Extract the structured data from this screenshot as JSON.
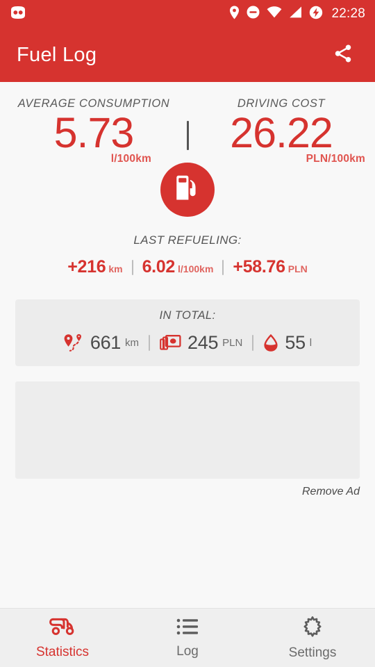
{
  "statusbar": {
    "notification_icon": "cyanogenmod-head-icon",
    "icons": [
      "location-pin-icon",
      "do-not-disturb-icon",
      "wifi-icon",
      "cellular-signal-icon",
      "battery-charging-icon"
    ],
    "time": "22:28"
  },
  "appbar": {
    "title": "Fuel Log",
    "share_label": "Share",
    "icon": "share-icon",
    "bg_color": "#D6332F"
  },
  "summary": {
    "average_consumption": {
      "label": "AVERAGE CONSUMPTION",
      "value": "5.73",
      "unit": "l/100km"
    },
    "driving_cost": {
      "label": "DRIVING COST",
      "value": "26.22",
      "unit": "PLN/100km"
    },
    "badge_icon": "fuel-pump-icon"
  },
  "last_refueling": {
    "title": "LAST REFUELING:",
    "items": [
      {
        "value": "+216",
        "unit": "km"
      },
      {
        "value": "6.02",
        "unit": "l/100km"
      },
      {
        "value": "+58.76",
        "unit": "PLN"
      }
    ]
  },
  "in_total": {
    "title": "IN TOTAL:",
    "items": [
      {
        "icon": "route-pins-icon",
        "value": "661",
        "unit": "km"
      },
      {
        "icon": "banknotes-icon",
        "value": "245",
        "unit": "PLN"
      },
      {
        "icon": "fuel-drop-icon",
        "value": "55",
        "unit": "l"
      }
    ]
  },
  "ad": {
    "placeholder": "",
    "remove_label": "Remove Ad"
  },
  "bottom_nav": {
    "items": [
      {
        "label": "Statistics",
        "icon": "scooter-icon",
        "active": true
      },
      {
        "label": "Log",
        "icon": "list-icon",
        "active": false
      },
      {
        "label": "Settings",
        "icon": "gear-icon",
        "active": false
      }
    ]
  },
  "colors": {
    "accent": "#D6332F",
    "accent_light": "#E0544F",
    "background": "#F8F8F8",
    "card": "#ECECEC",
    "nav_bg": "#EFEFEF",
    "text_dark": "#4A4A4A",
    "text_muted": "#6B6B6B"
  }
}
